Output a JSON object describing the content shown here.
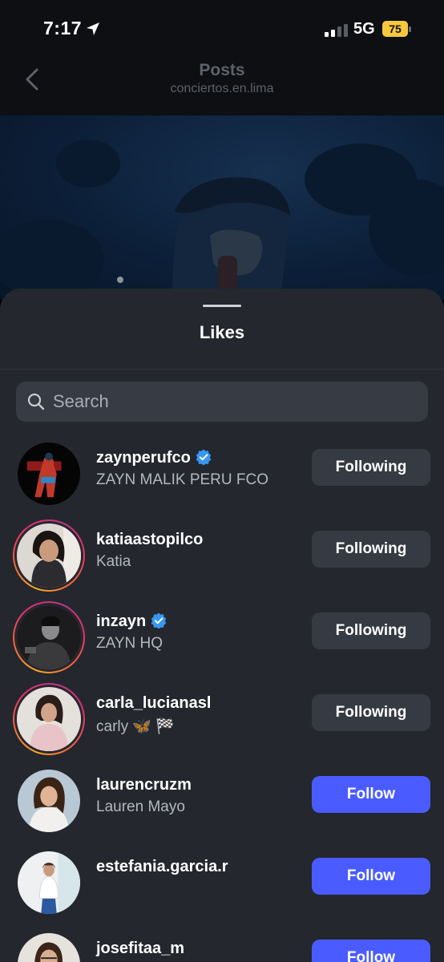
{
  "status_bar": {
    "time": "7:17",
    "network": "5G",
    "battery": "75"
  },
  "header": {
    "title": "Posts",
    "subtitle": "conciertos.en.lima"
  },
  "sheet": {
    "title": "Likes"
  },
  "search": {
    "placeholder": "Search",
    "value": ""
  },
  "users": [
    {
      "username": "zaynperufco",
      "full_name": "ZAYN MALIK PERU FCO",
      "verified": true,
      "button": "Following",
      "state": "following",
      "story": false
    },
    {
      "username": "katiaastopilco",
      "full_name": "Katia",
      "verified": false,
      "button": "Following",
      "state": "following",
      "story": true
    },
    {
      "username": "inzayn",
      "full_name": "ZAYN HQ",
      "verified": true,
      "button": "Following",
      "state": "following",
      "story": true
    },
    {
      "username": "carla_lucianasl",
      "full_name": "carly 🦋 🏁",
      "verified": false,
      "button": "Following",
      "state": "following",
      "story": true
    },
    {
      "username": "laurencruzm",
      "full_name": "Lauren Mayo",
      "verified": false,
      "button": "Follow",
      "state": "follow",
      "story": false
    },
    {
      "username": "estefania.garcia.r",
      "full_name": "",
      "verified": false,
      "button": "Follow",
      "state": "follow",
      "story": false
    },
    {
      "username": "josefitaa_m",
      "full_name": "",
      "verified": false,
      "button": "Follow",
      "state": "follow",
      "story": false
    }
  ],
  "colors": {
    "follow_button": "#4a5cff",
    "following_button": "#363a43",
    "sheet_bg": "#24272e",
    "verified": "#3897f0",
    "battery": "#f7c83b"
  }
}
